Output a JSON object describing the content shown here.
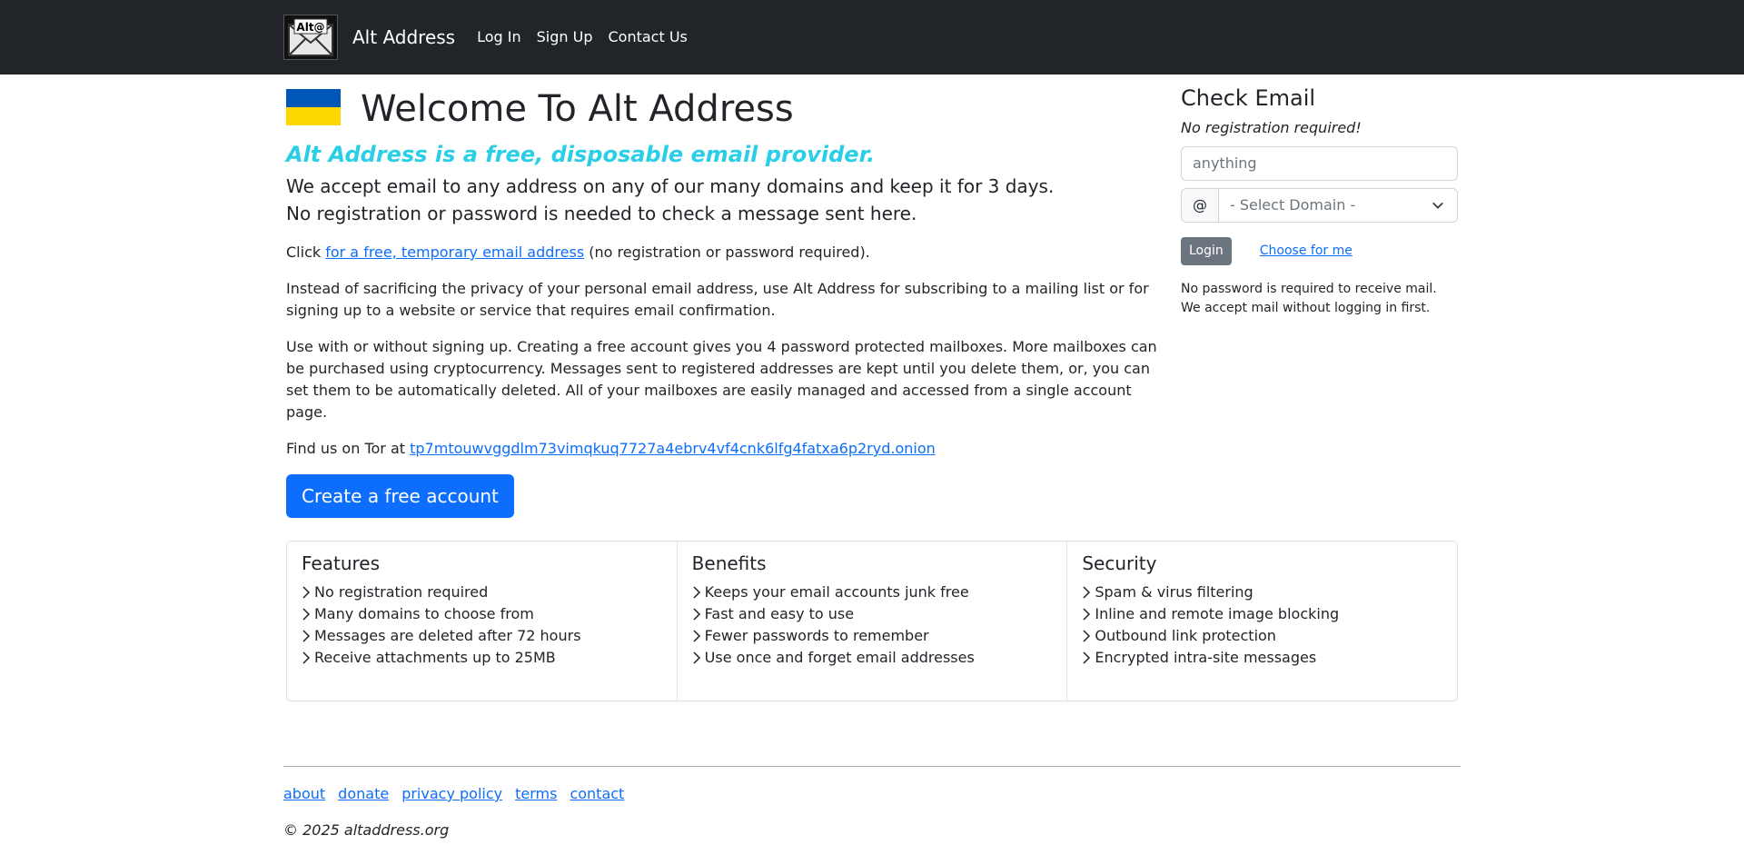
{
  "nav": {
    "brand": "Alt Address",
    "logo_text": "Alt@",
    "links": [
      "Log In",
      "Sign Up",
      "Contact Us"
    ]
  },
  "main": {
    "title": "Welcome To Alt Address",
    "tagline": "Alt Address is a free, disposable email provider.",
    "lead_1": "We accept email to any address on any of our many domains and keep it for 3 days.",
    "lead_2": "No registration or password is needed to check a message sent here.",
    "p1_before": "Click",
    "p1_link": "for a free, temporary email address",
    "p1_after": "(no registration or password required).",
    "p2": "Instead of sacrificing the privacy of your personal email address, use Alt Address for subscribing to a mailing list or for signing up to a website or service that requires email confirmation.",
    "p3": "Use with or without signing up. Creating a free account gives you 4 password protected mailboxes. More mailboxes can be purchased using cryptocurrency. Messages sent to registered addresses are kept until you delete them, or, you can set them to be automatically deleted. All of your mailboxes are easily managed and accessed from a single account page.",
    "p4_before": "Find us on Tor at",
    "p4_link": "tp7mtouwvggdlm73vimqkuq7727a4ebrv4vf4cnk6lfg4fatxa6p2ryd.onion",
    "cta": "Create a free account"
  },
  "side": {
    "title": "Check Email",
    "noreg": "No registration required!",
    "email_placeholder": "anything",
    "at": "@",
    "domain_selected": "- Select Domain -",
    "login": "Login",
    "choose": "Choose for me",
    "note_1": "No password is required to receive mail.",
    "note_2": "We accept mail without logging in first."
  },
  "cards": [
    {
      "title": "Features",
      "items": [
        "No registration required",
        "Many domains to choose from",
        "Messages are deleted after 72 hours",
        "Receive attachments up to 25MB"
      ]
    },
    {
      "title": "Benefits",
      "items": [
        "Keeps your email accounts junk free",
        "Fast and easy to use",
        "Fewer passwords to remember",
        "Use once and forget email addresses"
      ]
    },
    {
      "title": "Security",
      "items": [
        "Spam & virus filtering",
        "Inline and remote image blocking",
        "Outbound link protection",
        "Encrypted intra-site messages"
      ]
    }
  ],
  "footer": {
    "links": [
      "about",
      "donate",
      "privacy policy",
      "terms",
      "contact"
    ],
    "copyright": "© 2025 altaddress.org"
  },
  "colors": {
    "navbar": "#212529",
    "primary": "#0d6efd",
    "tagline": "#2acfe7",
    "flag_blue": "#0057b8",
    "flag_yellow": "#ffd700"
  }
}
